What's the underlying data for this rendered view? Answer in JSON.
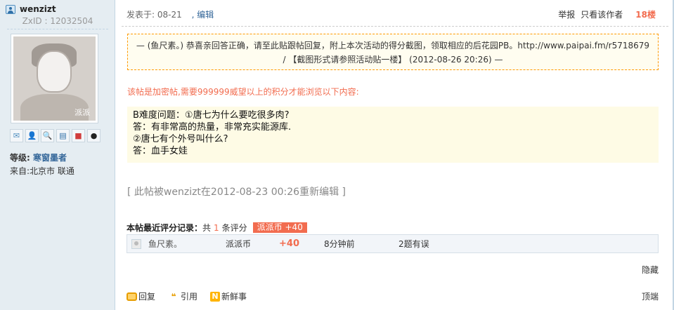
{
  "user": {
    "name": "wenzizt",
    "id_text": "ZxID : 12032504",
    "avatar_mark": "派派",
    "level_label": "等级:",
    "level_value": "寒窗墨者",
    "from": "来自:北京市 联通"
  },
  "post": {
    "posted": "发表于: 08-21",
    "edit_label": ", 编辑",
    "report": "举报",
    "only_author": "只看该作者",
    "floor": "18楼",
    "notice_line1": "— (鱼尺素。) 恭喜亲回答正确，请至此贴跟帖回复，附上本次活动的得分截图，领取相应的后花园PB。http://www.paipai.fm/r5718679",
    "notice_line2": "/ 【截图形式请参照活动贴一楼】 (2012-08-26 20:26) —",
    "lock_msg": "该帖是加密帖,需要999999威望以上的积分才能浏览以下内容:",
    "content": [
      "B难度问题：①唐七为什么要吃很多肉?",
      "答：有非常高的热量，非常充实能源库.",
      "②唐七有个外号叫什么?",
      "答：血手女娃"
    ],
    "edit_note": "[ 此帖被wenzizt在2012-08-23 00:26重新编辑 ]"
  },
  "rating": {
    "title": "本帖最近评分记录：",
    "count_prefix": "共",
    "count": "1",
    "count_suffix": "条评分",
    "tag": "派派币 +40",
    "row": {
      "name": "鱼尺素。",
      "currency": "派派币",
      "value": "+40",
      "time": "8分钟前",
      "reason": "2题有误"
    }
  },
  "actions": {
    "hide": "隐藏",
    "reply": "回复",
    "quote": "引用",
    "news": "新鲜事",
    "top": "顶端"
  },
  "colors": {
    "accent": "#f26c4f",
    "side_bg": "#e5edf2",
    "link": "#336699"
  }
}
